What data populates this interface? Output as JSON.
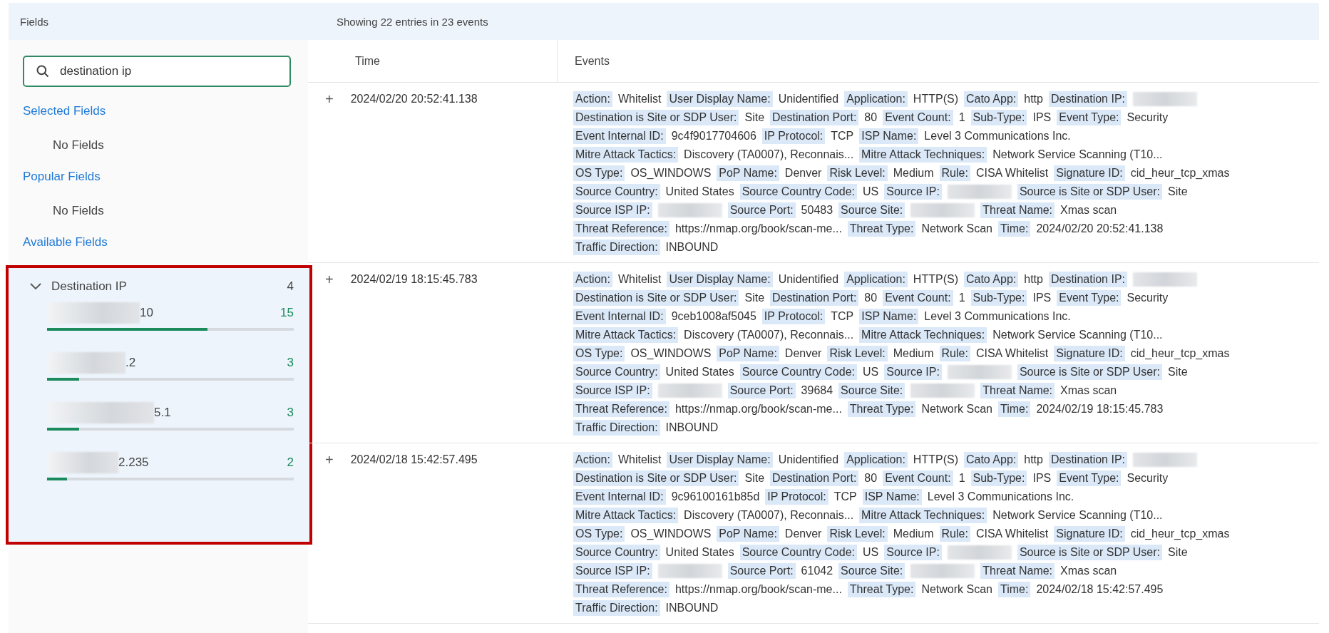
{
  "sidebar": {
    "title": "Fields",
    "search": {
      "value": "destination ip"
    },
    "sections": [
      {
        "heading": "Selected Fields",
        "empty_text": "No Fields"
      },
      {
        "heading": "Popular Fields",
        "empty_text": "No Fields"
      },
      {
        "heading": "Available Fields"
      }
    ],
    "field_group": {
      "name": "Destination IP",
      "count": "4",
      "expanded": true,
      "highlighted": true,
      "values": [
        {
          "text": "10",
          "masked": true,
          "count": "15",
          "level": 0.65
        },
        {
          "text": ".2",
          "masked": true,
          "count": "3",
          "level": 0.13
        },
        {
          "text": "5.1",
          "masked": true,
          "count": "3",
          "level": 0.13
        },
        {
          "text": "2.235",
          "masked": true,
          "count": "2",
          "level": 0.08
        }
      ]
    }
  },
  "main": {
    "summary": "Showing 22 entries in 23 events",
    "columns": [
      "Time",
      "Events"
    ],
    "rows": [
      {
        "expand": "+",
        "time": "2024/02/20 20:52:41.138",
        "lines": [
          [
            {
              "label": "Action:",
              "value": "Whitelist"
            },
            {
              "label": "User Display Name:",
              "value": "Unidentified"
            },
            {
              "label": "Application:",
              "value": "HTTP(S)"
            },
            {
              "label": "Cato App:",
              "value": "http"
            },
            {
              "label": "Destination IP:",
              "masked": true
            }
          ],
          [
            {
              "label": "Destination is Site or SDP User:",
              "value": "Site"
            },
            {
              "label": "Destination Port:",
              "value": "80"
            },
            {
              "label": "Event Count:",
              "value": "1"
            },
            {
              "label": "Sub-Type:",
              "value": "IPS"
            },
            {
              "label": "Event Type:",
              "value": "Security"
            }
          ],
          [
            {
              "label": "Event Internal ID:",
              "value": "9c4f9017704606"
            },
            {
              "label": "IP Protocol:",
              "value": "TCP"
            },
            {
              "label": "ISP Name:",
              "value": "Level 3 Communications Inc."
            }
          ],
          [
            {
              "label": "Mitre Attack Tactics:",
              "value": "Discovery (TA0007), Reconnais..."
            },
            {
              "label": "Mitre Attack Techniques:",
              "value": "Network Service Scanning (T10..."
            }
          ],
          [
            {
              "label": "OS Type:",
              "value": "OS_WINDOWS"
            },
            {
              "label": "PoP Name:",
              "value": "Denver"
            },
            {
              "label": "Risk Level:",
              "value": "Medium"
            },
            {
              "label": "Rule:",
              "value": "CISA Whitelist"
            },
            {
              "label": "Signature ID:",
              "value": "cid_heur_tcp_xmas"
            }
          ],
          [
            {
              "label": "Source Country:",
              "value": "United States"
            },
            {
              "label": "Source Country Code:",
              "value": "US"
            },
            {
              "label": "Source IP:",
              "masked": true
            },
            {
              "label": "Source is Site or SDP User:",
              "value": "Site"
            }
          ],
          [
            {
              "label": "Source ISP IP:",
              "masked": true
            },
            {
              "label": "Source Port:",
              "value": "50483"
            },
            {
              "label": "Source Site:",
              "masked": true
            },
            {
              "label": "Threat Name:",
              "value": "Xmas scan"
            }
          ],
          [
            {
              "label": "Threat Reference:",
              "value": "https://nmap.org/book/scan-me..."
            },
            {
              "label": "Threat Type:",
              "value": "Network Scan"
            },
            {
              "label": "Time:",
              "value": "2024/02/20 20:52:41.138"
            }
          ],
          [
            {
              "label": "Traffic Direction:",
              "value": "INBOUND"
            }
          ]
        ]
      },
      {
        "expand": "+",
        "time": "2024/02/19 18:15:45.783",
        "lines": [
          [
            {
              "label": "Action:",
              "value": "Whitelist"
            },
            {
              "label": "User Display Name:",
              "value": "Unidentified"
            },
            {
              "label": "Application:",
              "value": "HTTP(S)"
            },
            {
              "label": "Cato App:",
              "value": "http"
            },
            {
              "label": "Destination IP:",
              "masked": true
            }
          ],
          [
            {
              "label": "Destination is Site or SDP User:",
              "value": "Site"
            },
            {
              "label": "Destination Port:",
              "value": "80"
            },
            {
              "label": "Event Count:",
              "value": "1"
            },
            {
              "label": "Sub-Type:",
              "value": "IPS"
            },
            {
              "label": "Event Type:",
              "value": "Security"
            }
          ],
          [
            {
              "label": "Event Internal ID:",
              "value": "9ceb1008af5045"
            },
            {
              "label": "IP Protocol:",
              "value": "TCP"
            },
            {
              "label": "ISP Name:",
              "value": "Level 3 Communications Inc."
            }
          ],
          [
            {
              "label": "Mitre Attack Tactics:",
              "value": "Discovery (TA0007), Reconnais..."
            },
            {
              "label": "Mitre Attack Techniques:",
              "value": "Network Service Scanning (T10..."
            }
          ],
          [
            {
              "label": "OS Type:",
              "value": "OS_WINDOWS"
            },
            {
              "label": "PoP Name:",
              "value": "Denver"
            },
            {
              "label": "Risk Level:",
              "value": "Medium"
            },
            {
              "label": "Rule:",
              "value": "CISA Whitelist"
            },
            {
              "label": "Signature ID:",
              "value": "cid_heur_tcp_xmas"
            }
          ],
          [
            {
              "label": "Source Country:",
              "value": "United States"
            },
            {
              "label": "Source Country Code:",
              "value": "US"
            },
            {
              "label": "Source IP:",
              "masked": true
            },
            {
              "label": "Source is Site or SDP User:",
              "value": "Site"
            }
          ],
          [
            {
              "label": "Source ISP IP:",
              "masked": true
            },
            {
              "label": "Source Port:",
              "value": "39684"
            },
            {
              "label": "Source Site:",
              "masked": true
            },
            {
              "label": "Threat Name:",
              "value": "Xmas scan"
            }
          ],
          [
            {
              "label": "Threat Reference:",
              "value": "https://nmap.org/book/scan-me..."
            },
            {
              "label": "Threat Type:",
              "value": "Network Scan"
            },
            {
              "label": "Time:",
              "value": "2024/02/19 18:15:45.783"
            }
          ],
          [
            {
              "label": "Traffic Direction:",
              "value": "INBOUND"
            }
          ]
        ]
      },
      {
        "expand": "+",
        "time": "2024/02/18 15:42:57.495",
        "lines": [
          [
            {
              "label": "Action:",
              "value": "Whitelist"
            },
            {
              "label": "User Display Name:",
              "value": "Unidentified"
            },
            {
              "label": "Application:",
              "value": "HTTP(S)"
            },
            {
              "label": "Cato App:",
              "value": "http"
            },
            {
              "label": "Destination IP:",
              "masked": true
            }
          ],
          [
            {
              "label": "Destination is Site or SDP User:",
              "value": "Site"
            },
            {
              "label": "Destination Port:",
              "value": "80"
            },
            {
              "label": "Event Count:",
              "value": "1"
            },
            {
              "label": "Sub-Type:",
              "value": "IPS"
            },
            {
              "label": "Event Type:",
              "value": "Security"
            }
          ],
          [
            {
              "label": "Event Internal ID:",
              "value": "9c96100161b85d"
            },
            {
              "label": "IP Protocol:",
              "value": "TCP"
            },
            {
              "label": "ISP Name:",
              "value": "Level 3 Communications Inc."
            }
          ],
          [
            {
              "label": "Mitre Attack Tactics:",
              "value": "Discovery (TA0007), Reconnais..."
            },
            {
              "label": "Mitre Attack Techniques:",
              "value": "Network Service Scanning (T10..."
            }
          ],
          [
            {
              "label": "OS Type:",
              "value": "OS_WINDOWS"
            },
            {
              "label": "PoP Name:",
              "value": "Denver"
            },
            {
              "label": "Risk Level:",
              "value": "Medium"
            },
            {
              "label": "Rule:",
              "value": "CISA Whitelist"
            },
            {
              "label": "Signature ID:",
              "value": "cid_heur_tcp_xmas"
            }
          ],
          [
            {
              "label": "Source Country:",
              "value": "United States"
            },
            {
              "label": "Source Country Code:",
              "value": "US"
            },
            {
              "label": "Source IP:",
              "masked": true
            },
            {
              "label": "Source is Site or SDP User:",
              "value": "Site"
            }
          ],
          [
            {
              "label": "Source ISP IP:",
              "masked": true
            },
            {
              "label": "Source Port:",
              "value": "61042"
            },
            {
              "label": "Source Site:",
              "masked": true
            },
            {
              "label": "Threat Name:",
              "value": "Xmas scan"
            }
          ],
          [
            {
              "label": "Threat Reference:",
              "value": "https://nmap.org/book/scan-me..."
            },
            {
              "label": "Threat Type:",
              "value": "Network Scan"
            },
            {
              "label": "Time:",
              "value": "2024/02/18 15:42:57.495"
            }
          ],
          [
            {
              "label": "Traffic Direction:",
              "value": "INBOUND"
            }
          ]
        ]
      }
    ]
  }
}
